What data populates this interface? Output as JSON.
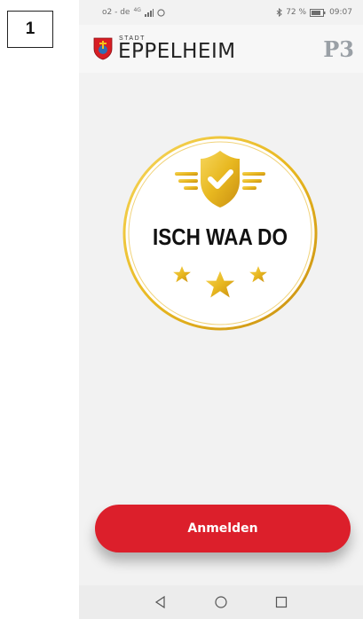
{
  "step": {
    "number": "1"
  },
  "statusbar": {
    "carrier": "o2 - de",
    "network": "4G",
    "battery": "72 %",
    "time": "09:07"
  },
  "header": {
    "brand_small": "STADT",
    "brand_name": "EPPELHEIM",
    "partner_logo": "P3"
  },
  "badge": {
    "text": "ISCH WAA DO",
    "icon": "shield-check-icon",
    "stars": 3
  },
  "login_button": {
    "label": "Anmelden"
  },
  "navbar": {
    "back": "back-triangle-icon",
    "home": "home-circle-icon",
    "recents": "recents-square-icon"
  },
  "colors": {
    "accent": "#dc1f2b",
    "gold": "#e8b820",
    "background": "#f2f2f2"
  }
}
